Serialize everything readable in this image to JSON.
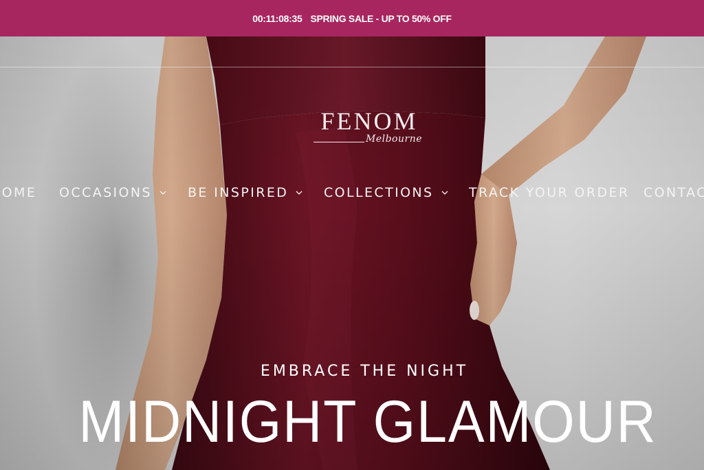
{
  "announcement": {
    "countdown": "00:11:08:35",
    "text": "SPRING SALE - UP TO 50% OFF",
    "background": "#a8265f"
  },
  "logo": {
    "brand": "FENOM",
    "location": "Melbourne"
  },
  "nav": {
    "items": [
      {
        "label": "HOME",
        "has_dropdown": false
      },
      {
        "label": "OCCASIONS",
        "has_dropdown": true,
        "icon": "chevron-down-icon"
      },
      {
        "label": "BE INSPIRED",
        "has_dropdown": true,
        "icon": "chevron-down-icon"
      },
      {
        "label": "COLLECTIONS",
        "has_dropdown": true,
        "icon": "chevron-down-icon"
      },
      {
        "label": "TRACK YOUR ORDER",
        "has_dropdown": false
      },
      {
        "label": "CONTACT",
        "has_dropdown": false
      }
    ]
  },
  "hero": {
    "eyebrow": "EMBRACE THE NIGHT",
    "headline": "MIDNIGHT GLAMOUR",
    "image_subject": "woman in burgundy velvet strapless dress",
    "dress_color": "#5a0e1c"
  }
}
